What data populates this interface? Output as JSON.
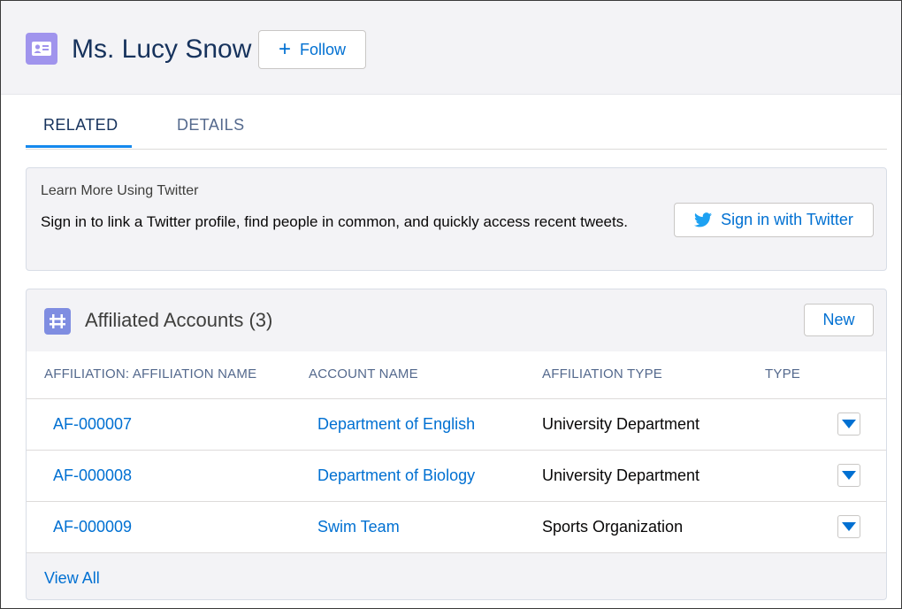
{
  "header": {
    "title": "Ms. Lucy Snow",
    "follow_label": "Follow",
    "record_icon": "contact-card-icon"
  },
  "tabs": [
    {
      "label": "RELATED",
      "active": true
    },
    {
      "label": "DETAILS",
      "active": false
    }
  ],
  "twitter": {
    "heading": "Learn More Using Twitter",
    "body": "Sign in to link a Twitter profile, find people in common, and quickly access recent tweets.",
    "button_label": "Sign in with Twitter"
  },
  "affiliations": {
    "title": "Affiliated Accounts (3)",
    "new_label": "New",
    "columns": [
      "AFFILIATION: AFFILIATION NAME",
      "ACCOUNT NAME",
      "AFFILIATION TYPE",
      "TYPE"
    ],
    "rows": [
      {
        "name": "AF-000007",
        "account": "Department of English",
        "affiliation_type": "University Department",
        "type": ""
      },
      {
        "name": "AF-000008",
        "account": "Department of Biology",
        "affiliation_type": "University Department",
        "type": ""
      },
      {
        "name": "AF-000009",
        "account": "Swim Team",
        "affiliation_type": "Sports Organization",
        "type": ""
      }
    ],
    "view_all_label": "View All"
  },
  "colors": {
    "link": "#0070d2",
    "header_bg": "#f3f3f6",
    "contact_icon_bg": "#a094ed",
    "affiliation_icon_bg": "#7f8de1",
    "tab_active_underline": "#1589ee",
    "twitter_blue": "#1da1f2"
  }
}
